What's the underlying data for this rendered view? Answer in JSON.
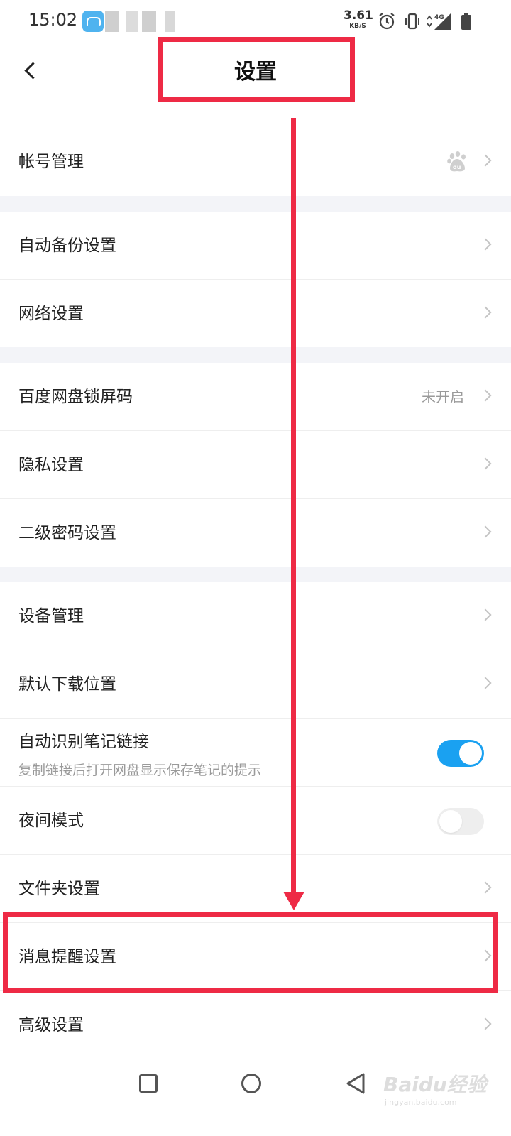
{
  "status_bar": {
    "time": "15:02",
    "net_speed": "3.61",
    "net_speed_unit": "KB/S",
    "network_type": "4G"
  },
  "header": {
    "title": "设置"
  },
  "groups": [
    [
      {
        "label": "帐号管理",
        "type": "link",
        "icon": "baidu-paw-icon"
      }
    ],
    [
      {
        "label": "自动备份设置",
        "type": "link"
      },
      {
        "label": "网络设置",
        "type": "link"
      }
    ],
    [
      {
        "label": "百度网盘锁屏码",
        "type": "link",
        "value": "未开启"
      },
      {
        "label": "隐私设置",
        "type": "link"
      },
      {
        "label": "二级密码设置",
        "type": "link"
      }
    ],
    [
      {
        "label": "设备管理",
        "type": "link"
      },
      {
        "label": "默认下载位置",
        "type": "link"
      },
      {
        "label": "自动识别笔记链接",
        "sublabel": "复制链接后打开网盘显示保存笔记的提示",
        "type": "toggle",
        "on": true
      },
      {
        "label": "夜间模式",
        "type": "toggle",
        "on": false
      },
      {
        "label": "文件夹设置",
        "type": "link"
      },
      {
        "label": "消息提醒设置",
        "type": "link"
      },
      {
        "label": "高级设置",
        "type": "link"
      }
    ]
  ],
  "watermark": {
    "text": "Baidu经验",
    "url_text": "jingyan.baidu.com"
  },
  "colors": {
    "accent_toggle": "#1aa1f1",
    "annotation_red": "#ee2a45",
    "group_gap": "#f3f4f8"
  }
}
